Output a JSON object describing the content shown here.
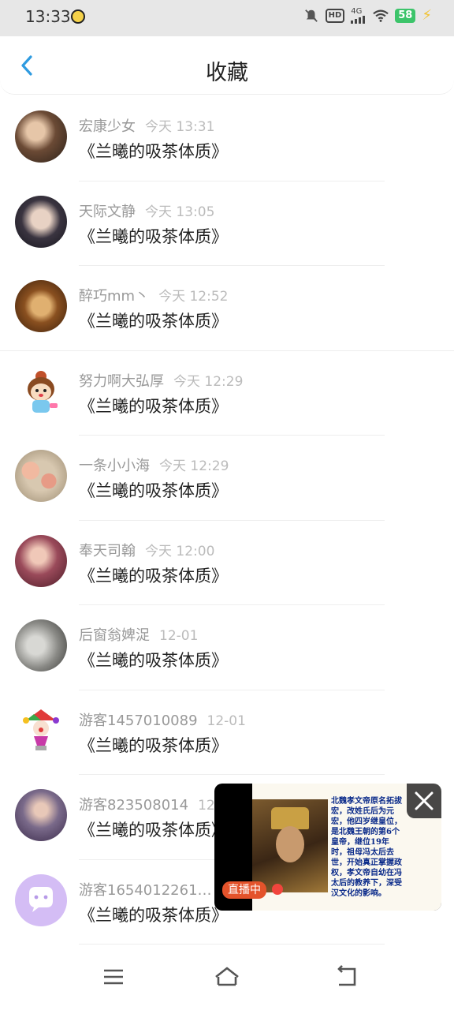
{
  "status_bar": {
    "time": "13:33",
    "network": "4G",
    "hd": "HD",
    "battery": "58",
    "icons": [
      "app-notification-icon",
      "mute-bell-icon",
      "hd-icon",
      "signal-icon",
      "wifi-icon",
      "battery-icon",
      "charging-icon"
    ]
  },
  "header": {
    "title": "收藏",
    "back_icon": "chevron-left-icon",
    "accent": "#2f9be0"
  },
  "items": [
    {
      "name": "宏康少女",
      "time": "今天 13:31",
      "message": "《兰曦的吸茶体质》",
      "avatar_color": "#5a4a3a"
    },
    {
      "name": "天际文静",
      "time": "今天 13:05",
      "message": "《兰曦的吸茶体质》",
      "avatar_color": "#2b2b33"
    },
    {
      "name": "醉巧mm丶",
      "time": "今天 12:52",
      "message": "《兰曦的吸茶体质》",
      "avatar_color": "#6b3f1a"
    },
    {
      "name": "努力啊大弘厚",
      "time": "今天 12:29",
      "message": "《兰曦的吸茶体质》",
      "avatar_color": "#f6d9a8"
    },
    {
      "name": "一条小小海",
      "time": "今天 12:29",
      "message": "《兰曦的吸茶体质》",
      "avatar_color": "#d8a88a"
    },
    {
      "name": "奉天司翰",
      "time": "今天 12:00",
      "message": "《兰曦的吸茶体质》",
      "avatar_color": "#7a3a44"
    },
    {
      "name": "后窗翁婢浞",
      "time": "12-01",
      "message": "《兰曦的吸茶体质》",
      "avatar_color": "#8a8a88"
    },
    {
      "name": "游客1457010089",
      "time": "12-01",
      "message": "《兰曦的吸茶体质》",
      "avatar_color": "#ffffff"
    },
    {
      "name": "游客823508014",
      "time": "12-",
      "message": "《兰曦的吸茶体质》",
      "avatar_color": "#7a6a8a"
    },
    {
      "name": "游客1654012261…",
      "time": "",
      "message": "《兰曦的吸茶体质》",
      "avatar_color": "#d4bdf5"
    }
  ],
  "live_window": {
    "badge": "直播中",
    "text": "北魏孝文帝原名拓拔宏，改姓氏后为元宏，他四岁继皇位，是北魏王朝的第6个皇帝，继位19年时，祖母冯太后去世，开始真正掌握政权，孝文帝自幼在冯太后的教养下，深受汉文化的影响。",
    "close_icon": "close-icon"
  },
  "nav_bar": {
    "icons": [
      "menu-icon",
      "home-icon",
      "back-icon"
    ]
  }
}
